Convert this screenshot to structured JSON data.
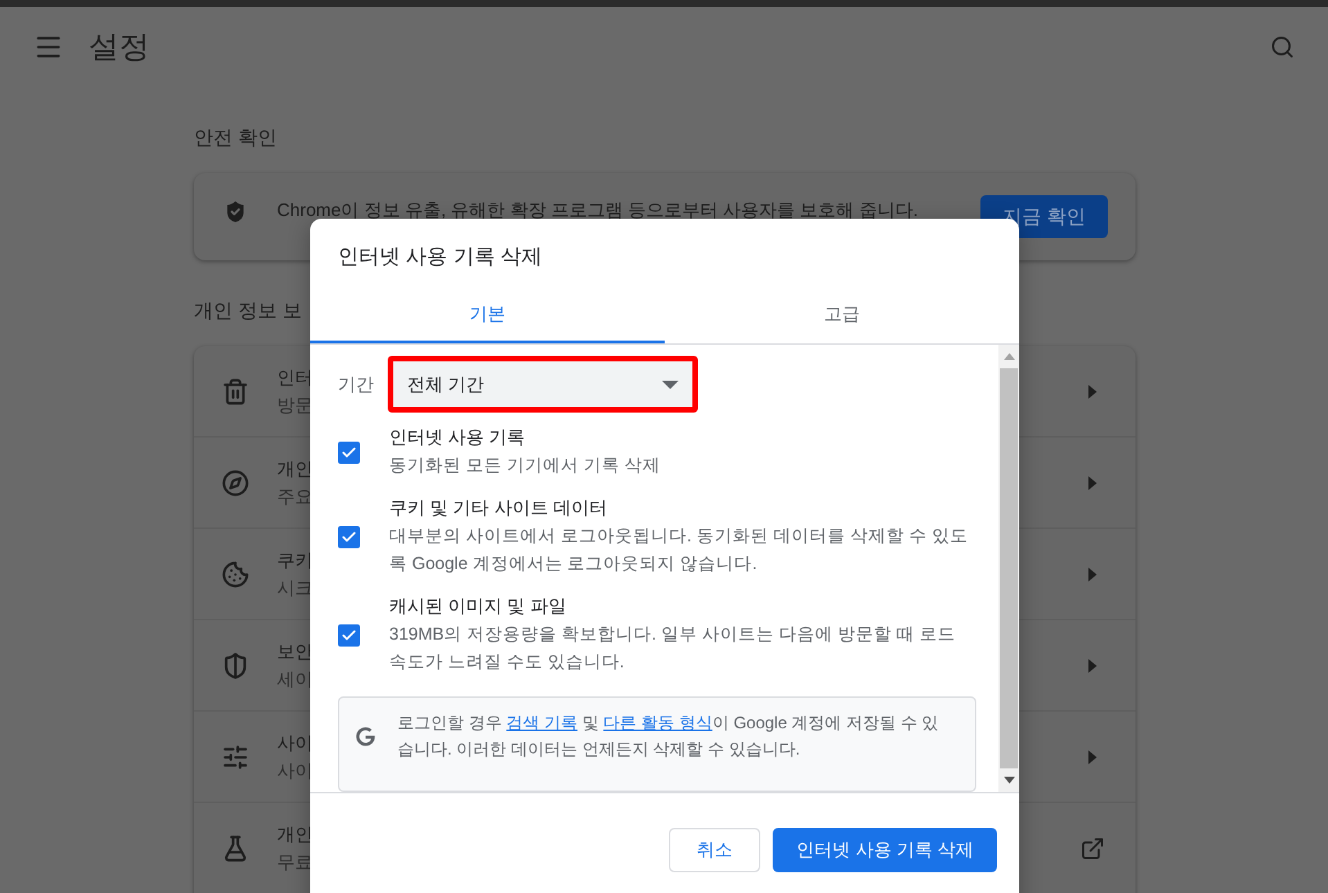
{
  "header": {
    "title": "설정"
  },
  "safety_check": {
    "heading": "안전 확인",
    "description": "Chrome이 정보 유출, 유해한 확장 프로그램 등으로부터 사용자를 보호해 줍니다.",
    "button": "지금 확인"
  },
  "privacy": {
    "heading": "개인 정보 보",
    "rows": [
      {
        "title": "인터",
        "subtitle": "방문"
      },
      {
        "title": "개인",
        "subtitle": "주요"
      },
      {
        "title": "쿠키",
        "subtitle": "시크"
      },
      {
        "title": "보안",
        "subtitle": "세이"
      },
      {
        "title": "사이",
        "subtitle": "사이"
      },
      {
        "title": "개인",
        "subtitle": "무료"
      }
    ]
  },
  "dialog": {
    "title": "인터넷 사용 기록 삭제",
    "tabs": [
      {
        "label": "기본",
        "selected": true
      },
      {
        "label": "고급",
        "selected": false
      }
    ],
    "period": {
      "label": "기간",
      "value": "전체 기간",
      "highlighted": true
    },
    "options": [
      {
        "title": "인터넷 사용 기록",
        "description": "동기화된 모든 기기에서 기록 삭제",
        "checked": true
      },
      {
        "title": "쿠키 및 기타 사이트 데이터",
        "description": "대부분의 사이트에서 로그아웃됩니다. 동기화된 데이터를 삭제할 수 있도록 Google 계정에서는 로그아웃되지 않습니다.",
        "checked": true
      },
      {
        "title": "캐시된 이미지 및 파일",
        "description": "319MB의 저장용량을 확보합니다. 일부 사이트는 다음에 방문할 때 로드 속도가 느려질 수도 있습니다.",
        "checked": true
      }
    ],
    "info": {
      "parts": [
        {
          "text": "로그인할 경우 "
        },
        {
          "text": "검색 기록",
          "link": true
        },
        {
          "text": " 및 "
        },
        {
          "text": "다른 활동 형식",
          "link": true
        },
        {
          "text": "이 Google 계정에 저장될 수 있습니다. 이러한 데이터는 언제든지 삭제할 수 있습니다."
        }
      ]
    },
    "buttons": [
      {
        "label": "취소",
        "kind": "secondary"
      },
      {
        "label": "인터넷 사용 기록 삭제",
        "kind": "primary"
      }
    ]
  }
}
